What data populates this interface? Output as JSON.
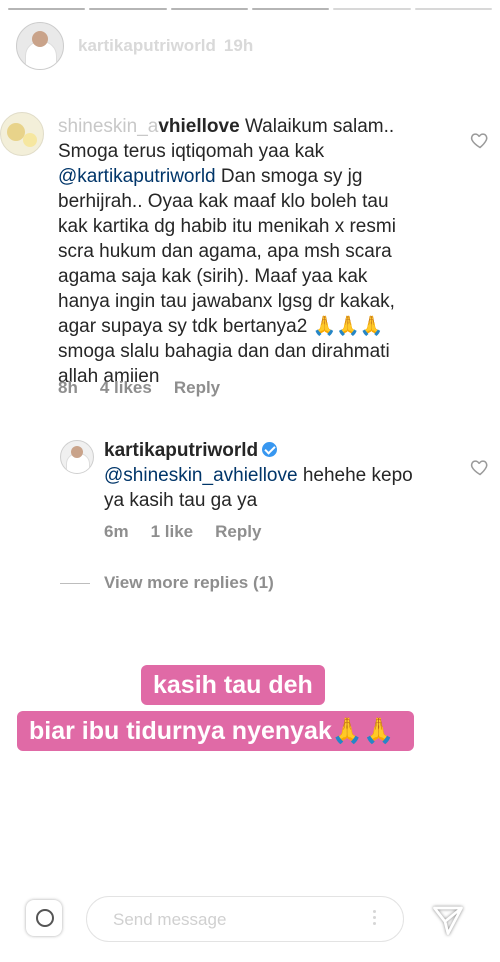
{
  "story": {
    "username": "kartikaputriworld",
    "time": "19h",
    "progress_segments": 6
  },
  "comment": {
    "username_faded": "shineskin_a",
    "username": "vhiellove",
    "line1_rest": " Walaikum salam..",
    "line2": "Smoga terus iqtiqomah yaa kak",
    "mention": "@kartikaputriworld",
    "line3_rest": " Dan smoga sy jg",
    "line4": "berhijrah.. Oyaa kak maaf klo boleh tau",
    "line5": "kak kartika dg habib itu menikah x resmi",
    "line6": "scra hukum dan agama, apa msh scara",
    "line7": "agama saja kak (sirih). Maaf yaa kak",
    "line8": "hanya ingin tau jawabanx lgsg dr kakak,",
    "line9": "agar supaya sy tdk bertanya2 🙏🙏🙏",
    "line10": "smoga slalu bahagia dan dan dirahmati",
    "line11": "allah amiien",
    "time": "8h",
    "likes": "4 likes",
    "reply": "Reply",
    "like_icon": "heart-outline-icon"
  },
  "reply": {
    "username": "kartikaputriworld",
    "verified_icon": "verified-badge-icon",
    "mention": "@shineskin_avhiellove",
    "text_rest": " hehehe kepo",
    "line2": "ya kasih tau ga ya",
    "time": "6m",
    "likes": "1 like",
    "reply": "Reply"
  },
  "view_more": "View more replies (1)",
  "stickers": {
    "line1": "kasih tau deh",
    "line2": "biar ibu tidurnya nyenyak",
    "line2_emoji": "🙏🙏",
    "color": "#e06aa6"
  },
  "message_bar": {
    "placeholder": "Send message",
    "camera_icon": "camera-icon",
    "more_icon": "more-vertical-icon",
    "send_icon": "send-direct-icon"
  }
}
